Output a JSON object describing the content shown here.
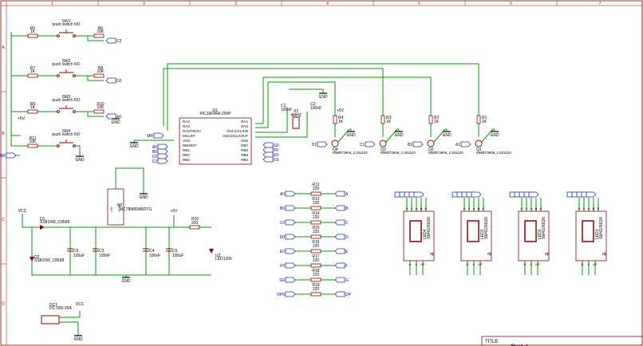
{
  "frame": {
    "col_labels": [
      "1",
      "2",
      "3",
      "4",
      "5",
      "6",
      "7"
    ],
    "row_labels": [
      "A",
      "B",
      "C",
      "D"
    ],
    "title_label": "TITLE:",
    "title_value": "Sheet_1"
  },
  "power": {
    "gnd": "GND",
    "vcc": "VCC",
    "p5v": "+5V"
  },
  "switches": [
    {
      "ref": "SW1",
      "desc": "push switch NO",
      "res_a": "R5",
      "res_a_val": "1K",
      "res_b": "R6",
      "res_b_val": "10K",
      "net": "C3"
    },
    {
      "ref": "SW2",
      "desc": "push switch NO",
      "res_a": "R7",
      "res_a_val": "1K",
      "res_b": "R8",
      "res_b_val": "10K",
      "net": "D0"
    },
    {
      "ref": "SW3",
      "desc": "push switch NO",
      "res_a": "R9",
      "res_a_val": "1K",
      "res_b": "R10",
      "res_b_val": "10K",
      "net": "A0"
    },
    {
      "ref": "SW4",
      "desc": "push switch NO",
      "res_a": "R11",
      "res_a_val": "10K",
      "net": "MR"
    }
  ],
  "mcu": {
    "ref": "U1",
    "part": "PIC16F84A-20I/P",
    "left_pins": [
      "RA2",
      "RA3",
      "RA4/T0CKI",
      "MCLR#",
      "VSS",
      "RB0/INT",
      "RB1",
      "RB2",
      "RB3"
    ],
    "right_pins": [
      "RA1",
      "RA0",
      "OSC1/CLKIN",
      "OSC2/CLKOUT",
      "VDD",
      "RB7",
      "RB6",
      "RB5",
      "RB4"
    ],
    "left_nets": [
      "MR",
      "D0",
      "A0",
      "B0",
      "C0",
      "C3"
    ],
    "right_nets": [
      "G0",
      "F0",
      "E0",
      "D0"
    ]
  },
  "osc": {
    "c1": "C1",
    "c1_val": "100nF",
    "c2": "C2",
    "c2_val": "100nF",
    "x1": "X1",
    "x1_val": "4MHZ"
  },
  "transistors": [
    {
      "ref": "Q1",
      "part": "MMBT3906_C181120",
      "res": "R1",
      "res_val": "1K",
      "net": "A1"
    },
    {
      "ref": "Q2",
      "part": "MMBT3906_C181120",
      "res": "R2",
      "res_val": "1K",
      "net": "B1"
    },
    {
      "ref": "Q3",
      "part": "MMBT3906_C181120",
      "res": "R3",
      "res_val": "1K",
      "net": "C1"
    },
    {
      "ref": "Q4",
      "part": "MMBT3906_C181120",
      "res": "R4",
      "res_val": "1K",
      "net": "D1"
    }
  ],
  "power_supply": {
    "u2": "U2",
    "u2_part": "MC78M05ABDTG",
    "vin": "VIN",
    "vout": "VOUT",
    "d1": "D1",
    "d1_part": "SS810W_C8598",
    "d2": "D2",
    "d2_part": "SS810W_C8598",
    "c6": "C6",
    "c6_val": "100uF",
    "c3": "C3",
    "c3_val": "100nF",
    "c4": "C4",
    "c4_val": "100nF",
    "c5": "C5",
    "c5_val": "100uF",
    "r20": "R20",
    "r20_val": "220",
    "u3": "U3",
    "u3_part": "LED1206",
    "dc1": "DC1",
    "dc1_part": "DC-005-25A"
  },
  "res_array": [
    {
      "ref": "R12",
      "val": "220",
      "in": "A0",
      "out": "A"
    },
    {
      "ref": "R13",
      "val": "220",
      "in": "B0",
      "out": "B"
    },
    {
      "ref": "R14",
      "val": "220",
      "in": "C0",
      "out": "C"
    },
    {
      "ref": "R15",
      "val": "220",
      "in": "D0",
      "out": "D"
    },
    {
      "ref": "R16",
      "val": "220",
      "in": "E0",
      "out": "E"
    },
    {
      "ref": "R17",
      "val": "220",
      "in": "F0",
      "out": "F"
    },
    {
      "ref": "R18",
      "val": "220",
      "in": "G0",
      "out": "G"
    },
    {
      "ref": "R19",
      "val": "220",
      "in": "DP0",
      "out": "DP"
    }
  ],
  "displays": [
    {
      "ref": "LED4",
      "part": "SM410561N"
    },
    {
      "ref": "LED3",
      "part": "SM410561N"
    },
    {
      "ref": "LED2",
      "part": "SM410561N"
    },
    {
      "ref": "LED1",
      "part": "SM410561N"
    }
  ],
  "seg_top_pins": [
    "G",
    "F",
    "A",
    "B",
    "E"
  ],
  "seg_bot_pins": [
    "D",
    "C",
    "DP"
  ],
  "dp_label": "dp",
  "colors": {
    "wire": "#009900",
    "part": "#8b0000",
    "ref": "#0000cc",
    "frame": "#8b0000",
    "net": "#000080",
    "text": "#000000"
  }
}
